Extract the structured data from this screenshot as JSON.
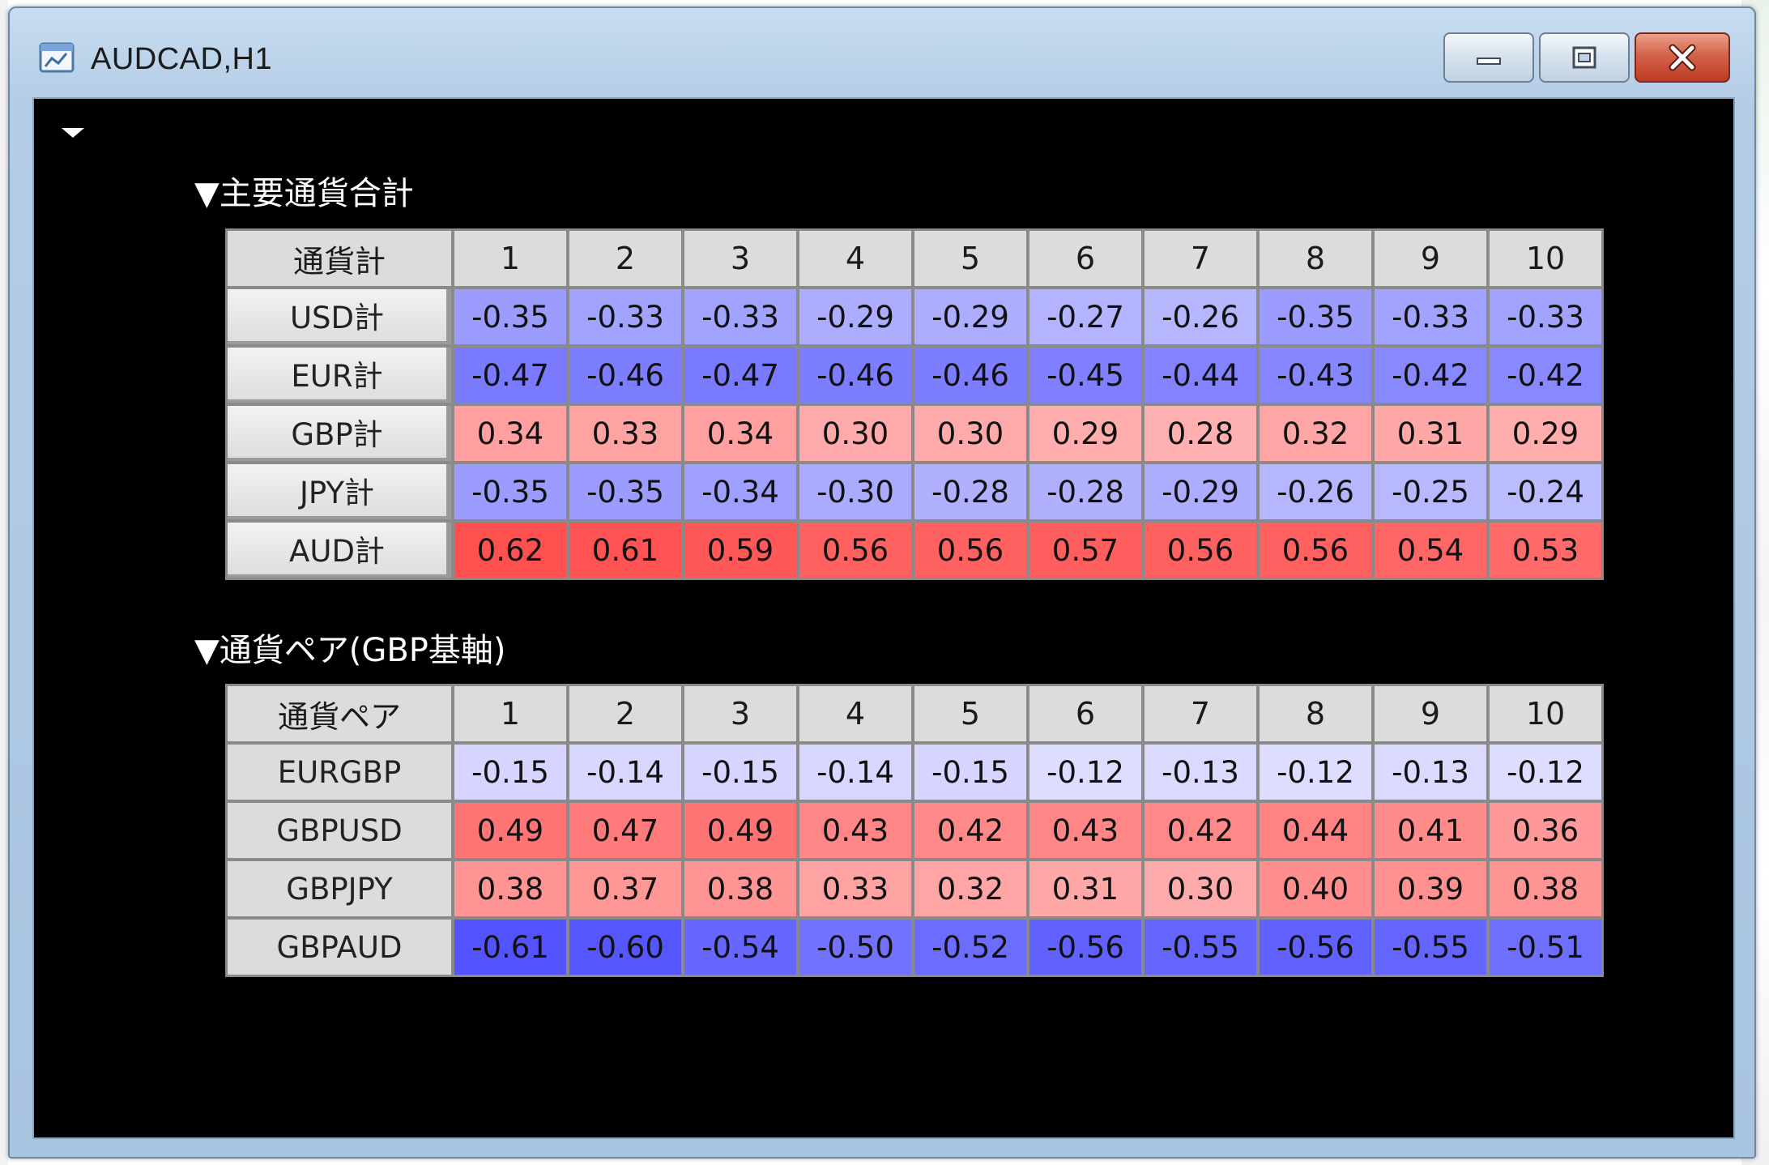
{
  "window": {
    "title": "AUDCAD,H1"
  },
  "section1": {
    "title": "▼主要通貨合計",
    "header_label": "通貨計",
    "columns": [
      "1",
      "2",
      "3",
      "4",
      "5",
      "6",
      "7",
      "8",
      "9",
      "10"
    ],
    "rows": [
      {
        "label": "USD計",
        "values": [
          "-0.35",
          "-0.33",
          "-0.33",
          "-0.29",
          "-0.29",
          "-0.27",
          "-0.26",
          "-0.35",
          "-0.33",
          "-0.33"
        ]
      },
      {
        "label": "EUR計",
        "values": [
          "-0.47",
          "-0.46",
          "-0.47",
          "-0.46",
          "-0.46",
          "-0.45",
          "-0.44",
          "-0.43",
          "-0.42",
          "-0.42"
        ]
      },
      {
        "label": "GBP計",
        "values": [
          "0.34",
          "0.33",
          "0.34",
          "0.30",
          "0.30",
          "0.29",
          "0.28",
          "0.32",
          "0.31",
          "0.29"
        ]
      },
      {
        "label": "JPY計",
        "values": [
          "-0.35",
          "-0.35",
          "-0.34",
          "-0.30",
          "-0.28",
          "-0.28",
          "-0.29",
          "-0.26",
          "-0.25",
          "-0.24"
        ]
      },
      {
        "label": "AUD計",
        "values": [
          "0.62",
          "0.61",
          "0.59",
          "0.56",
          "0.56",
          "0.57",
          "0.56",
          "0.56",
          "0.54",
          "0.53"
        ]
      }
    ]
  },
  "section2": {
    "title": "▼通貨ペア(GBP基軸)",
    "header_label": "通貨ペア",
    "columns": [
      "1",
      "2",
      "3",
      "4",
      "5",
      "6",
      "7",
      "8",
      "9",
      "10"
    ],
    "rows": [
      {
        "label": "EURGBP",
        "values": [
          "-0.15",
          "-0.14",
          "-0.15",
          "-0.14",
          "-0.15",
          "-0.12",
          "-0.13",
          "-0.12",
          "-0.13",
          "-0.12"
        ]
      },
      {
        "label": "GBPUSD",
        "values": [
          "0.49",
          "0.47",
          "0.49",
          "0.43",
          "0.42",
          "0.43",
          "0.42",
          "0.44",
          "0.41",
          "0.36"
        ]
      },
      {
        "label": "GBPJPY",
        "values": [
          "0.38",
          "0.37",
          "0.38",
          "0.33",
          "0.32",
          "0.31",
          "0.30",
          "0.40",
          "0.39",
          "0.38"
        ]
      },
      {
        "label": "GBPAUD",
        "values": [
          "-0.61",
          "-0.60",
          "-0.54",
          "-0.50",
          "-0.52",
          "-0.56",
          "-0.55",
          "-0.56",
          "-0.55",
          "-0.51"
        ]
      }
    ]
  },
  "colors": {
    "positive": "#ff5050",
    "negative": "#5050ff",
    "neutral": "#ffffff",
    "header_bg": "#dcdcdc",
    "client_bg": "#000000"
  },
  "icons": {
    "app": "window-icon",
    "minimize": "minimize-icon",
    "maximize": "maximize-icon",
    "close": "close-icon",
    "menu": "dropdown-triangle-icon"
  }
}
